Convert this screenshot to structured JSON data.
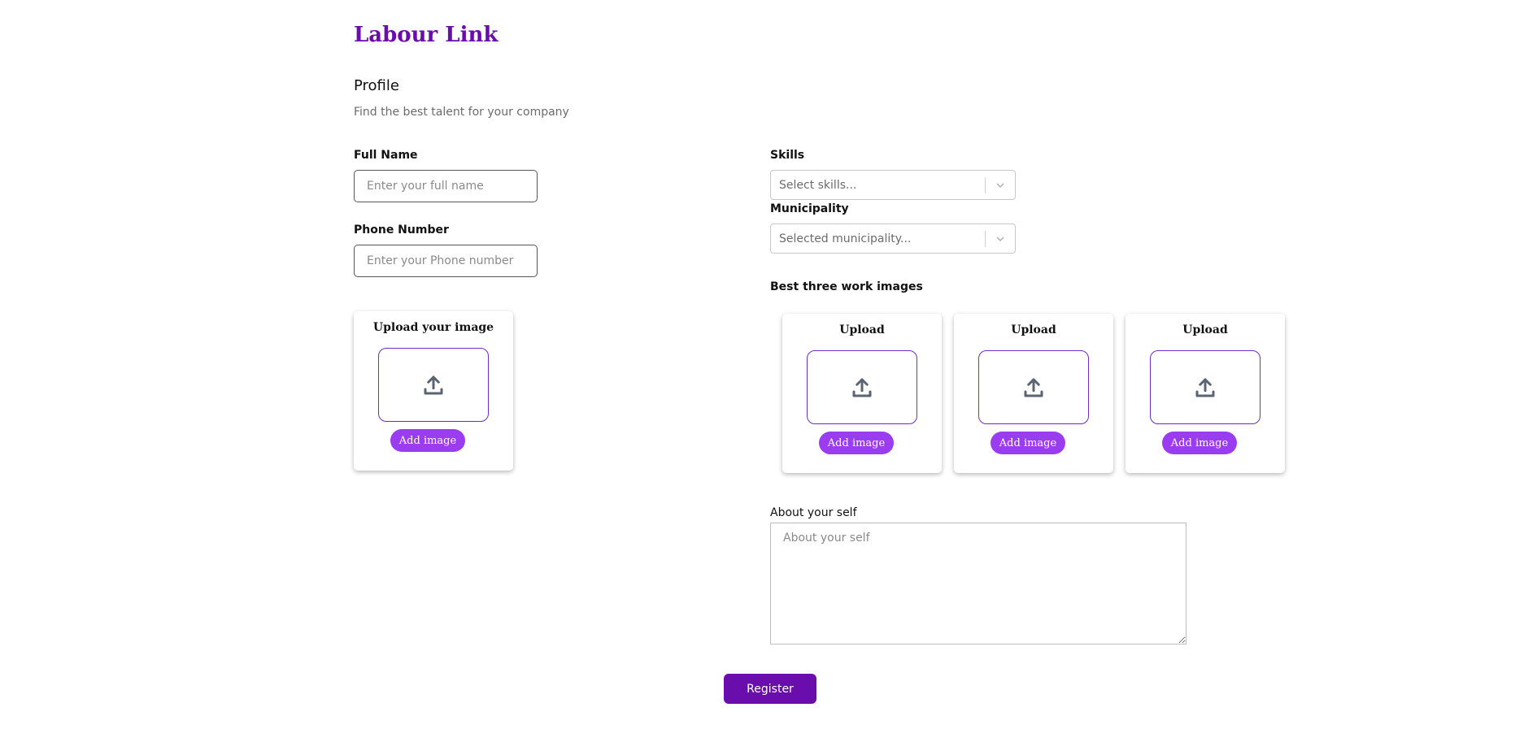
{
  "brand": {
    "name": "Labour Link"
  },
  "header": {
    "title": "Profile",
    "subtitle": "Find the best talent for your company"
  },
  "form": {
    "full_name": {
      "label": "Full Name",
      "placeholder": "Enter your full name",
      "value": ""
    },
    "phone": {
      "label": "Phone Number",
      "placeholder": "Enter your Phone number",
      "value": ""
    },
    "skills": {
      "label": "Skills",
      "placeholder": "Select skills..."
    },
    "municipality": {
      "label": "Municipality",
      "placeholder": "Selected municipality..."
    },
    "profile_image": {
      "title": "Upload your image",
      "button": "Add image",
      "icon": "upload-icon"
    },
    "work_images": {
      "label": "Best three work images",
      "cards": [
        {
          "title": "Upload",
          "button": "Add image",
          "icon": "upload-icon"
        },
        {
          "title": "Upload",
          "button": "Add image",
          "icon": "upload-icon"
        },
        {
          "title": "Upload",
          "button": "Add image",
          "icon": "upload-icon"
        }
      ]
    },
    "about": {
      "label": "About your self",
      "placeholder": "About your self",
      "value": ""
    },
    "submit_label": "Register"
  },
  "colors": {
    "brand": "#6a0dad",
    "accent_button": "#9a3cf0",
    "upload_border": "#6a2ec9"
  }
}
